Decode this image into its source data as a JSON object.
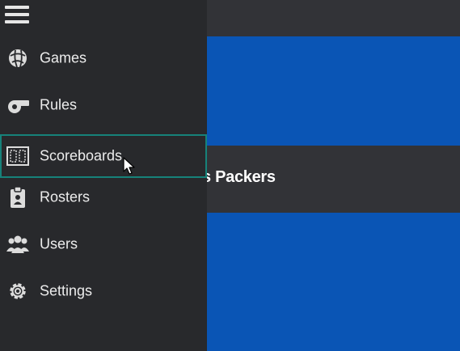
{
  "main": {
    "team_name": "s Packers"
  },
  "sidebar": {
    "menu_icon": "hamburger-menu-icon",
    "items": [
      {
        "label": "Games",
        "icon": "dice-icon"
      },
      {
        "label": "Rules",
        "icon": "whistle-icon"
      },
      {
        "label": "Scoreboards",
        "icon": "scoreboard-icon",
        "active": true
      },
      {
        "label": "Rosters",
        "icon": "clipboard-icon"
      },
      {
        "label": "Users",
        "icon": "users-icon"
      },
      {
        "label": "Settings",
        "icon": "gear-icon"
      }
    ]
  },
  "colors": {
    "sidebar_bg": "#28292c",
    "accent_border": "#16827a",
    "banner_blue": "#0a55b5"
  }
}
